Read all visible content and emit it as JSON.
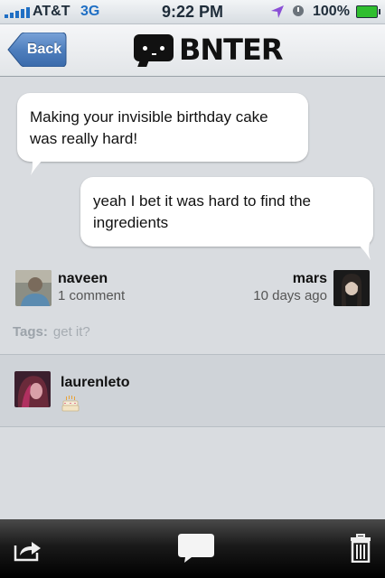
{
  "status_bar": {
    "carrier": "AT&T",
    "network": "3G",
    "time": "9:22 PM",
    "battery_percent": "100%",
    "signal_bars": 5,
    "icons": [
      "signal-icon",
      "location-arrow-icon",
      "alarm-clock-icon",
      "battery-icon"
    ]
  },
  "nav": {
    "back_label": "Back",
    "app_name": "BNTER",
    "logo_icon": "speech-bubble-face-icon"
  },
  "conversation": {
    "messages": [
      {
        "text": "Making your invisible birthday cake was really hard!",
        "side": "left"
      },
      {
        "text": "yeah I bet it was hard to find the ingredients",
        "side": "right"
      }
    ],
    "left_user": {
      "name": "naveen",
      "meta": "1 comment"
    },
    "right_user": {
      "name": "mars",
      "meta": "10 days ago"
    },
    "tags_label": "Tags:",
    "tags_value": "get it?"
  },
  "comments": [
    {
      "author": "laurenleto",
      "content_icon": "birthday-cake-icon"
    }
  ],
  "toolbar": {
    "icons": [
      "share-icon",
      "comment-icon",
      "trash-icon"
    ]
  },
  "colors": {
    "background": "#d9dce0",
    "back_button": "#4a79b4",
    "network_3g": "#1f6fc4",
    "battery_fill": "#2fbe2f",
    "toolbar": "#111111"
  }
}
